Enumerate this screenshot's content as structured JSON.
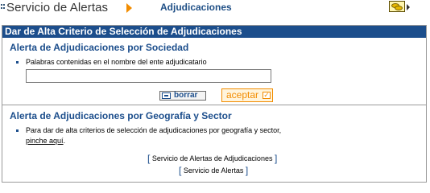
{
  "header": {
    "app_title": "Servicio de Alertas",
    "section_link": "Adjudicaciones",
    "icons": {
      "dots": "dots-icon",
      "arrow": "arrow-right-icon",
      "coins": "coins-icon"
    }
  },
  "panel": {
    "title": "Dar de Alta Criterio de Selección de Adjudicaciones",
    "sociedad": {
      "title": "Alerta de Adjudicaciones por Sociedad",
      "field_label": "Palabras contenidas en el nombre del ente adjudicatario",
      "field_value": "",
      "borrar_label": "borrar",
      "aceptar_label": "aceptar",
      "check_glyph": "✓"
    },
    "geografia": {
      "title": "Alerta de Adjudicaciones por Geografía y Sector",
      "text": "Para dar de alta criterios de selección de adjudicaciones por geografía y sector,",
      "link_label": "pinche aquí",
      "link_suffix": "."
    },
    "footer_links": {
      "alertas_adjudicaciones": "Servicio de Alertas de Adjudicaciones",
      "servicio_alertas": "Servicio de Alertas"
    }
  },
  "colors": {
    "brand_blue": "#1c4e8c",
    "accent_orange": "#f28c00"
  }
}
